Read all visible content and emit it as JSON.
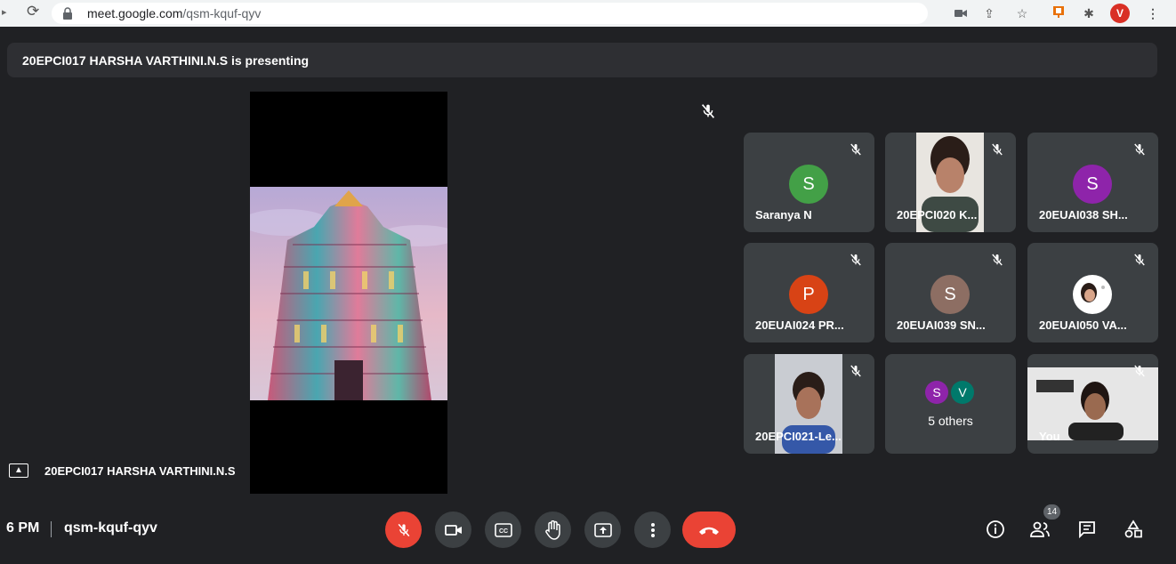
{
  "browser": {
    "url_host": "meet.google.com",
    "url_path": "/qsm-kquf-qyv",
    "profile_initial": "V"
  },
  "banner": {
    "text": "20EPCI017 HARSHA VARTHINI.N.S is presenting"
  },
  "presenter": {
    "name": "20EPCI017 HARSHA VARTHINI.N.S"
  },
  "tiles": [
    {
      "name": "Saranya N",
      "initial": "S",
      "color": "#43a047"
    },
    {
      "name": "20EPCI020 K..."
    },
    {
      "name": "20EUAI038 SH...",
      "initial": "S",
      "color": "#8e24aa"
    },
    {
      "name": "20EUAI024 PR...",
      "initial": "P",
      "color": "#d84315"
    },
    {
      "name": "20EUAI039 SN...",
      "initial": "S",
      "color": "#8d6e63"
    },
    {
      "name": "20EUAI050 VA..."
    },
    {
      "name": "20EPCI021-Le..."
    },
    {
      "others_count_label": "5 others",
      "initials": [
        "S",
        "V"
      ],
      "colors": [
        "#8e24aa",
        "#00796b"
      ]
    },
    {
      "name": "You"
    }
  ],
  "bottom": {
    "time": "6 PM",
    "meeting_code": "qsm-kquf-qyv",
    "participants_count": "14"
  },
  "colors": {
    "end_call": "#ea4335",
    "bar_bg": "#202124",
    "tile_bg": "#3c4043"
  }
}
